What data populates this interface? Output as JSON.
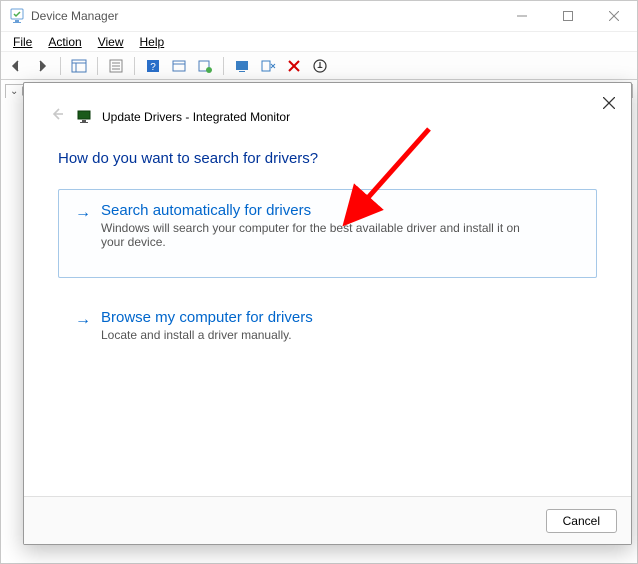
{
  "host": {
    "title": "Device Manager",
    "menu": {
      "file": "File",
      "action": "Action",
      "view": "View",
      "help": "Help"
    }
  },
  "dialog": {
    "title": "Update Drivers - Integrated Monitor",
    "question": "How do you want to search for drivers?",
    "option_auto": {
      "title": "Search automatically for drivers",
      "desc": "Windows will search your computer for the best available driver and install it on your device."
    },
    "option_browse": {
      "title": "Browse my computer for drivers",
      "desc": "Locate and install a driver manually."
    },
    "cancel": "Cancel"
  }
}
